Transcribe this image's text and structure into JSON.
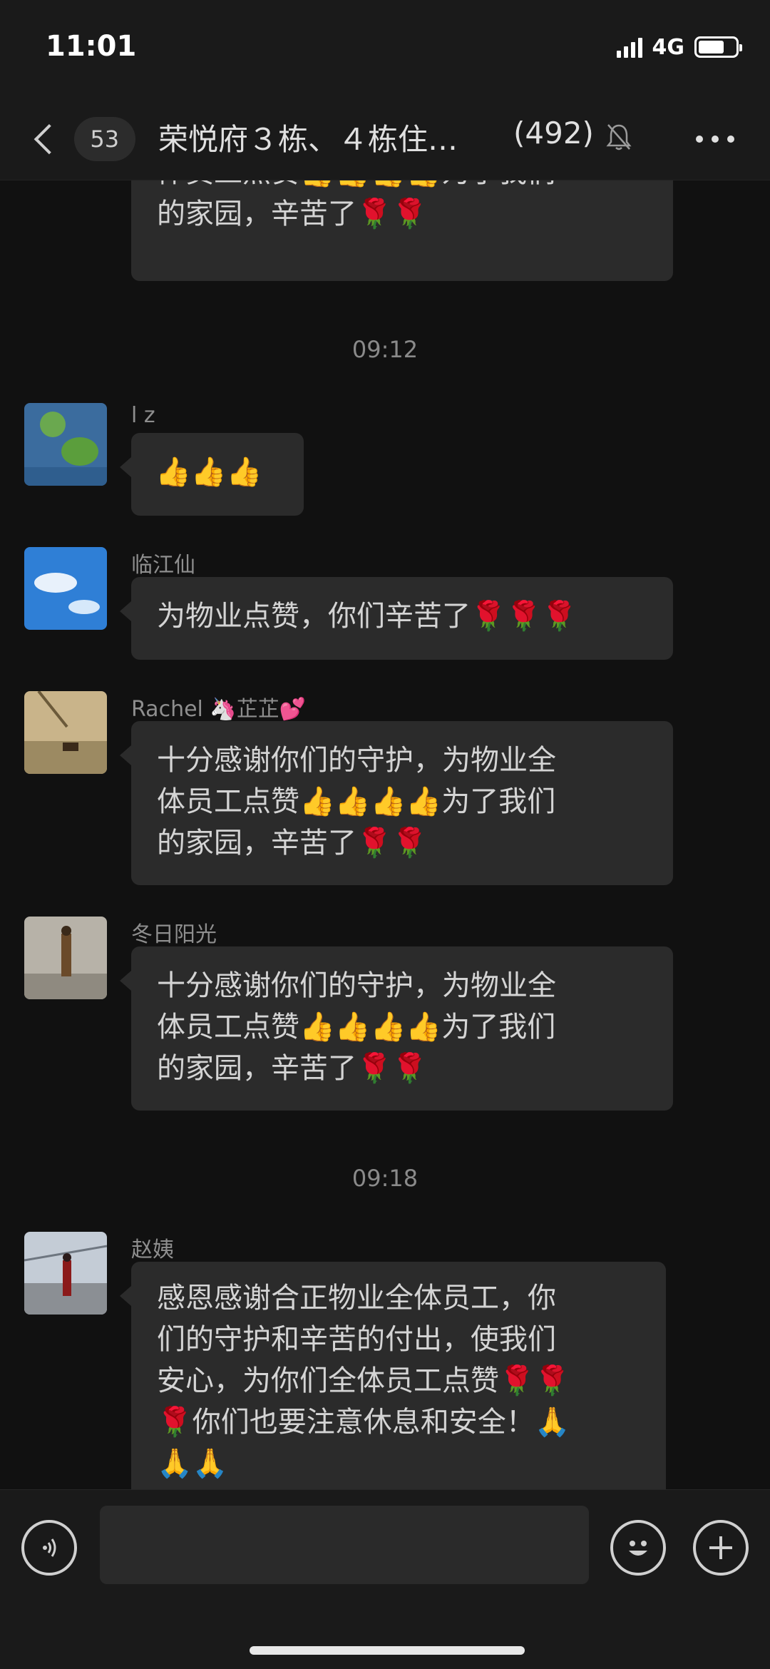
{
  "status_bar": {
    "time": "11:01",
    "network": "4G",
    "battery_level": 0.7
  },
  "nav": {
    "unread_count": "53",
    "title": "荣悦府３栋、４栋住…",
    "member_count": "(492)"
  },
  "messages": {
    "partial": {
      "lines": [
        "体员工点赞👍👍👍👍为了我们",
        "的家园，辛苦了🌹🌹"
      ]
    },
    "time1": "09:12",
    "m1": {
      "sender": "l z",
      "lines": [
        "👍👍👍"
      ]
    },
    "m2": {
      "sender": "临江仙",
      "lines": [
        "为物业点赞，你们辛苦了🌹🌹🌹"
      ]
    },
    "m3": {
      "sender": "Rachel 🦄芷芷💕",
      "lines": [
        "十分感谢你们的守护，为物业全",
        "体员工点赞👍👍👍👍为了我们",
        "的家园，辛苦了🌹🌹"
      ]
    },
    "m4": {
      "sender": "冬日阳光",
      "lines": [
        "十分感谢你们的守护，为物业全",
        "体员工点赞👍👍👍👍为了我们",
        "的家园，辛苦了🌹🌹"
      ]
    },
    "time2": "09:18",
    "m5": {
      "sender": "赵姨",
      "lines": [
        "感恩感谢合正物业全体员工，你",
        "们的守护和辛苦的付出，使我们",
        "安心，为你们全体员工点赞🌹🌹",
        "🌹你们也要注意休息和安全！🙏",
        "🙏🙏"
      ]
    }
  },
  "input": {
    "placeholder": ""
  },
  "icons": {
    "back": "chevron-left-icon",
    "mute": "bell-slash-icon",
    "more": "more-dots-icon",
    "voice": "voice-icon",
    "emoji": "emoji-icon",
    "plus": "plus-icon"
  }
}
